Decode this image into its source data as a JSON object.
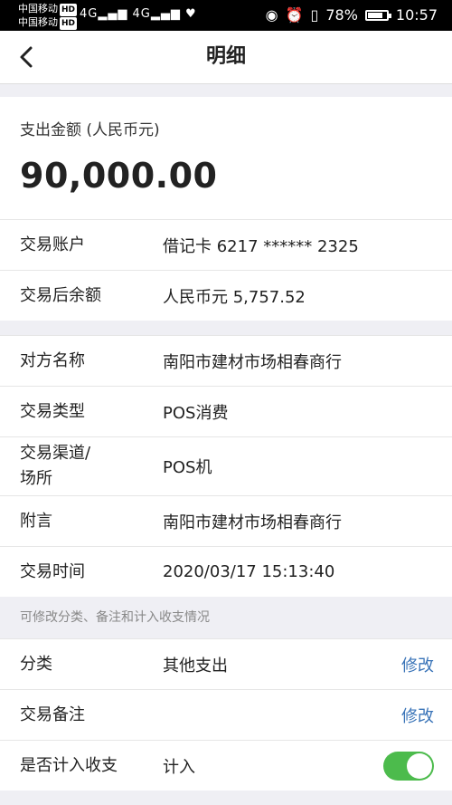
{
  "status": {
    "carrier1": "中国移动",
    "carrier2": "中国移动",
    "hd": "HD",
    "network": "4G",
    "battery": "78%",
    "battery_level": 0.78,
    "time": "10:57"
  },
  "nav": {
    "title": "明细"
  },
  "amount": {
    "label": "支出金额 (人民币元)",
    "value": "90,000.00"
  },
  "account_rows": [
    {
      "key": "交易账户",
      "value": "借记卡 6217 ****** 2325"
    },
    {
      "key": "交易后余额",
      "value": "人民币元 5,757.52"
    }
  ],
  "detail_rows": [
    {
      "key": "对方名称",
      "value": "南阳市建材市场相春商行"
    },
    {
      "key": "交易类型",
      "value": "POS消费"
    },
    {
      "key": "交易渠道/\n场所",
      "value": "POS机"
    },
    {
      "key": "附言",
      "value": "南阳市建材市场相春商行"
    },
    {
      "key": "交易时间",
      "value": "2020/03/17 15:13:40"
    }
  ],
  "hint": "可修改分类、备注和计入收支情况",
  "editable": {
    "category": {
      "key": "分类",
      "value": "其他支出",
      "edit": "修改"
    },
    "remark": {
      "key": "交易备注",
      "value": "",
      "edit": "修改"
    },
    "count": {
      "key": "是否计入收支",
      "value": "计入",
      "toggle_on": true
    }
  }
}
